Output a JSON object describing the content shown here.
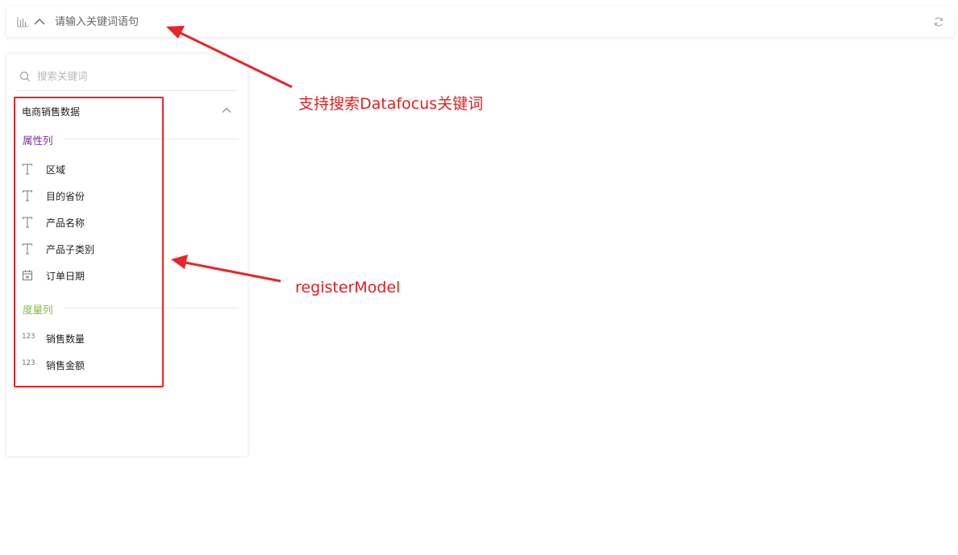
{
  "search_bar": {
    "placeholder": "请输入关键词语句",
    "icons": [
      "bar-chart-icon",
      "chevron-up-icon",
      "refresh-icon"
    ]
  },
  "side_panel": {
    "search_placeholder": "搜索关键词",
    "dataset_title": "电商销售数据",
    "sections": [
      {
        "label": "属性列",
        "color": "#7a2f98",
        "fields": [
          {
            "label": "区域",
            "icon": "text-type-icon"
          },
          {
            "label": "目的省份",
            "icon": "text-type-icon"
          },
          {
            "label": "产品名称",
            "icon": "text-type-icon"
          },
          {
            "label": "产品子类别",
            "icon": "text-type-icon"
          },
          {
            "label": "订单日期",
            "icon": "calendar-icon"
          }
        ]
      },
      {
        "label": "度量列",
        "color": "#7fbf3a",
        "fields": [
          {
            "label": "销售数量",
            "icon": "number-type-icon",
            "icon_text": "123"
          },
          {
            "label": "销售金额",
            "icon": "number-type-icon",
            "icon_text": "123"
          }
        ]
      }
    ]
  },
  "annotations": {
    "search_note": "支持搜索Datafocus关键词",
    "model_note": "registerModel",
    "color": "#e8252a"
  }
}
